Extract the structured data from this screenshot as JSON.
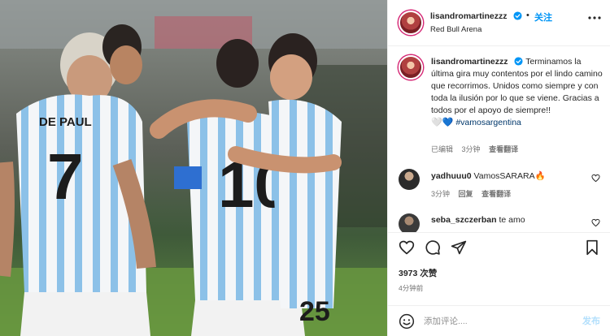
{
  "header": {
    "username": "lisandromartinezzz",
    "separator": "•",
    "follow_label": "关注",
    "location": "Red Bull Arena"
  },
  "caption": {
    "username": "lisandromartinezzz",
    "text": "Terminamos la última gira muy contentos por el lindo camino que recorrimos. Unidos como siempre y con toda la ilusión por lo que se viene. Gracias a todos por el apoyo de siempre!!",
    "hearts": "🤍💙",
    "hashtag": "#vamosargentina",
    "meta_edited": "已编辑",
    "meta_time": "3分钟",
    "meta_translate": "查看翻译"
  },
  "comments": [
    {
      "username": "yadhuuu0",
      "text": "VamosSARARA🔥",
      "time": "3分钟",
      "reply": "回复",
      "translate": "查看翻译"
    },
    {
      "username": "seba_szczerban",
      "text": "te amo"
    }
  ],
  "stats": {
    "likes": "3973 次赞",
    "time_ago": "4分钟前"
  },
  "composer": {
    "placeholder": "添加评论....",
    "post_label": "发布"
  },
  "colors": {
    "accent": "#0095f6",
    "post_disabled": "#b2dffc",
    "hashtag": "#00376b",
    "muted": "#737373"
  },
  "icons": [
    "verified-icon",
    "more-icon",
    "heart-icon",
    "comment-icon",
    "share-icon",
    "bookmark-icon",
    "emoji-icon"
  ]
}
